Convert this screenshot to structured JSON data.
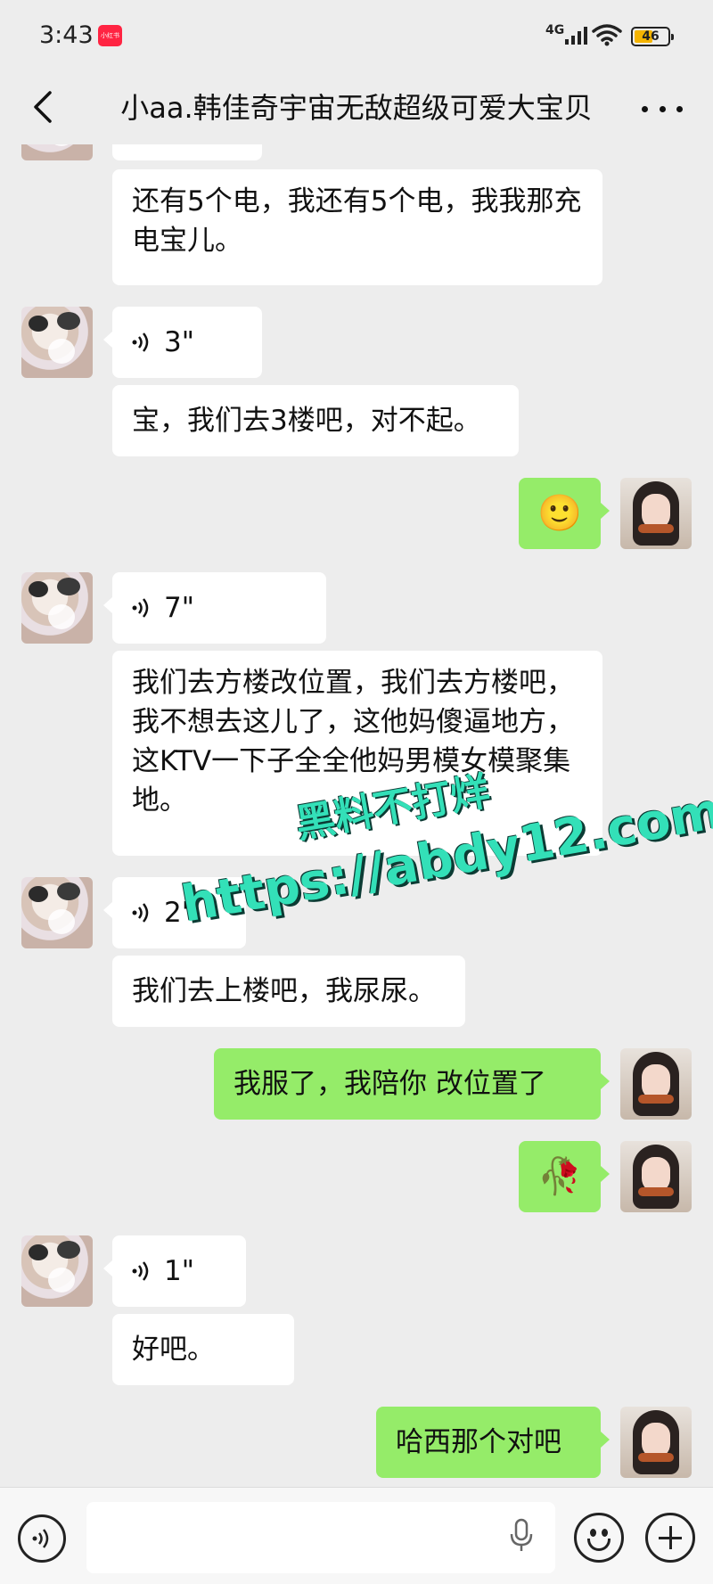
{
  "status_bar": {
    "time": "3:43",
    "app_badge": "小红书",
    "network": "4G",
    "battery": "46"
  },
  "header": {
    "back_icon": "chevron-left-icon",
    "title": "小aa.韩佳奇宇宙无敌超级可爱大宝贝",
    "more_icon": "more-icon"
  },
  "messages": [
    {
      "side": "in",
      "type": "text",
      "text": "还有5个电，我还有5个电，我我那充电宝儿。"
    },
    {
      "side": "in",
      "type": "voice",
      "duration": "3\""
    },
    {
      "side": "in",
      "type": "text",
      "text": "宝，我们去3楼吧，对不起。"
    },
    {
      "side": "out",
      "type": "emoji",
      "text": "🙂"
    },
    {
      "side": "in",
      "type": "voice",
      "duration": "7\""
    },
    {
      "side": "in",
      "type": "text",
      "text": "我们去方楼改位置，我们去方楼吧，我不想去这儿了，这他妈傻逼地方，这KTV一下子全全他妈男模女模聚集地。"
    },
    {
      "side": "in",
      "type": "voice",
      "duration": "2\""
    },
    {
      "side": "in",
      "type": "text",
      "text": "我们去上楼吧，我尿尿。"
    },
    {
      "side": "out",
      "type": "text",
      "text": "我服了，我陪你 改位置了"
    },
    {
      "side": "out",
      "type": "emoji",
      "text": "🥀"
    },
    {
      "side": "in",
      "type": "voice",
      "duration": "1\""
    },
    {
      "side": "in",
      "type": "text",
      "text": "好吧。"
    },
    {
      "side": "out",
      "type": "text",
      "text": "哈西那个对吧"
    }
  ],
  "watermark": {
    "line1": "黑料不打烊",
    "line2": "https://abdy12.com"
  },
  "input_bar": {
    "voice_icon": "voice-toggle-icon",
    "mic_icon": "microphone-icon",
    "emoji_icon": "emoji-icon",
    "plus_icon": "plus-icon"
  }
}
